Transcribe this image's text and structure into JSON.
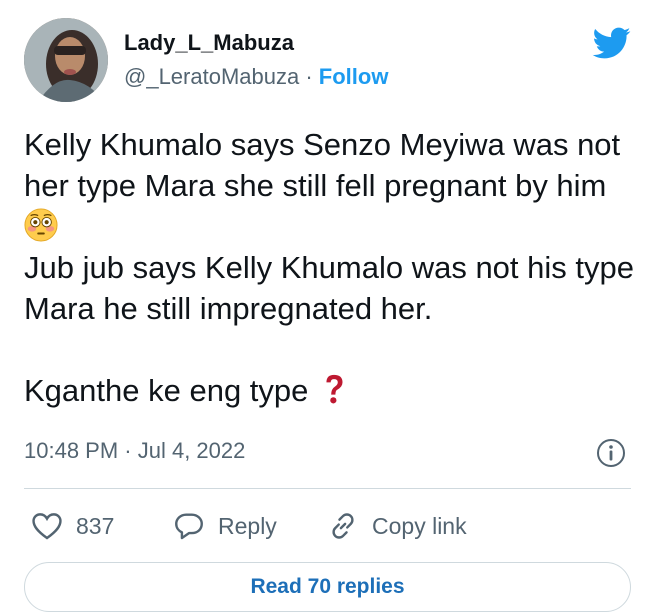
{
  "author": {
    "display_name": "Lady_L_Mabuza",
    "handle": "@_LeratoMabuza",
    "separator": " · ",
    "follow_label": "Follow"
  },
  "tweet": {
    "paragraphs": [
      "Kelly Khumalo says Senzo Meyiwa was not her type Mara she still fell pregnant by him",
      "Jub jub says Kelly Khumalo was not his type Mara he still impregnated her.",
      "Kganthe ke eng type"
    ],
    "emojis": [
      "flushed-face",
      "red-question-mark"
    ],
    "timestamp": "10:48 PM · Jul 4, 2022"
  },
  "actions": {
    "like_count": "837",
    "reply_label": "Reply",
    "copy_link_label": "Copy link"
  },
  "read_replies_label": "Read 70 replies",
  "icons": [
    "twitter-bird-icon",
    "info-icon",
    "heart-icon",
    "reply-bubble-icon",
    "link-icon"
  ],
  "colors": {
    "brand_blue": "#1d9bf0",
    "read_replies_blue": "#1d6fb8",
    "text_primary": "#0f1419",
    "text_secondary": "#536471",
    "border": "#cfd9de",
    "question_red": "#be1931"
  }
}
